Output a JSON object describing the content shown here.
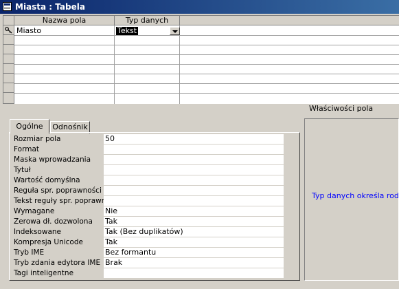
{
  "window": {
    "title": "Miasta : Tabela",
    "icon": "table-icon"
  },
  "grid": {
    "headers": [
      "Nazwa pola",
      "Typ danych"
    ],
    "rows": [
      {
        "field": "Miasto",
        "type": "Tekst",
        "primary_key": true
      }
    ]
  },
  "properties": {
    "section_title": "Właściwości pola",
    "tabs": [
      "Ogólne",
      "Odnośnik"
    ],
    "items": [
      {
        "label": "Rozmiar pola",
        "value": "50"
      },
      {
        "label": "Format",
        "value": ""
      },
      {
        "label": "Maska wprowadzania",
        "value": ""
      },
      {
        "label": "Tytuł",
        "value": ""
      },
      {
        "label": "Wartość domyślna",
        "value": ""
      },
      {
        "label": "Reguła spr. poprawności",
        "value": ""
      },
      {
        "label": "Tekst reguły spr. poprawr",
        "value": ""
      },
      {
        "label": "Wymagane",
        "value": "Nie"
      },
      {
        "label": "Zerowa dł. dozwolona",
        "value": "Tak"
      },
      {
        "label": "Indeksowane",
        "value": "Tak (Bez duplikatów)"
      },
      {
        "label": "Kompresja Unicode",
        "value": "Tak"
      },
      {
        "label": "Tryb IME",
        "value": "Bez formantu"
      },
      {
        "label": "Tryb zdania edytora IME",
        "value": "Brak"
      },
      {
        "label": "Tagi inteligentne",
        "value": ""
      }
    ],
    "help_text": "Typ danych określa rodzaj"
  }
}
